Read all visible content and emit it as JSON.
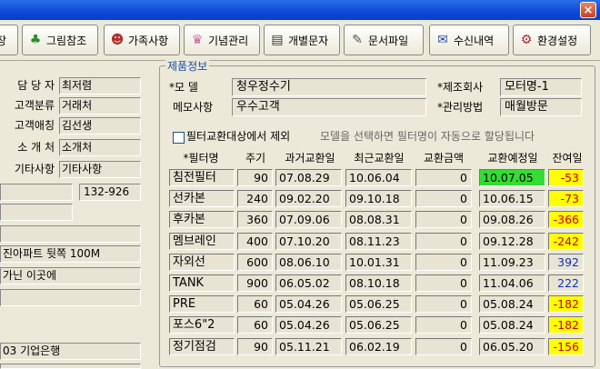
{
  "toolbar": {
    "buttons": [
      {
        "label": "장",
        "icon": "truncated-icon"
      },
      {
        "label": "그림참조",
        "icon": "tree-icon"
      },
      {
        "label": "가족사항",
        "icon": "family-icon"
      },
      {
        "label": "기념관리",
        "icon": "cake-icon"
      },
      {
        "label": "개별문자",
        "icon": "message-icon"
      },
      {
        "label": "문서파일",
        "icon": "document-icon"
      },
      {
        "label": "수신내역",
        "icon": "inbox-icon"
      },
      {
        "label": "환경설정",
        "icon": "settings-icon"
      }
    ]
  },
  "left": {
    "rows": [
      {
        "label": "담 당 자",
        "value": "최저렴"
      },
      {
        "label": "고객분류",
        "value": "거래처"
      },
      {
        "label": "고객애칭",
        "value": "김선생"
      },
      {
        "label": "소 개 처",
        "value": "소개처"
      },
      {
        "label": "기타사항",
        "value": "기타사항"
      }
    ],
    "postcode": "132-926",
    "address_line": "진아파트 뒷쪽 100M",
    "memo_line": "가닌 이곳에",
    "bank": "03 기업은행"
  },
  "product": {
    "section_title": "제품정보",
    "model_label": "*모    델",
    "model_value": "청우정수기",
    "manufacturer_label": "*제조회사",
    "manufacturer_value": "모터명-1",
    "memo_label": "메모사항",
    "memo_value": "우수고객",
    "manage_label": "*관리방법",
    "manage_value": "매월방문",
    "exclude_label": "필터교환대상에서 제외",
    "hint": "모델을 선택하면 필터명이 자동으로 할당됩니다",
    "columns": [
      "*필터명",
      "주기",
      "과거교환일",
      "최근교환일",
      "교환금액",
      "교환예정일",
      "잔여일"
    ],
    "rows": [
      {
        "name": "침전필터",
        "cycle": "90",
        "past": "07.08.29",
        "recent": "10.06.04",
        "amount": "0",
        "due": "10.07.05",
        "remain": "-53",
        "due_bg": "#33dd33",
        "remain_bg": "#ffff00",
        "remain_color": "#cc0000"
      },
      {
        "name": "선카본",
        "cycle": "240",
        "past": "09.02.20",
        "recent": "09.10.18",
        "amount": "0",
        "due": "10.06.15",
        "remain": "-73",
        "due_bg": "#e8e4d4",
        "remain_bg": "#ffff00",
        "remain_color": "#cc0000"
      },
      {
        "name": "후카본",
        "cycle": "360",
        "past": "07.09.06",
        "recent": "08.08.31",
        "amount": "0",
        "due": "09.08.26",
        "remain": "-366",
        "due_bg": "#e8e4d4",
        "remain_bg": "#ffff00",
        "remain_color": "#cc0000"
      },
      {
        "name": "멤브레인",
        "cycle": "400",
        "past": "07.10.20",
        "recent": "08.11.23",
        "amount": "0",
        "due": "09.12.28",
        "remain": "-242",
        "due_bg": "#e8e4d4",
        "remain_bg": "#ffff00",
        "remain_color": "#cc0000"
      },
      {
        "name": "자외선",
        "cycle": "600",
        "past": "08.06.10",
        "recent": "10.01.31",
        "amount": "0",
        "due": "11.09.23",
        "remain": "392",
        "due_bg": "#e8e4d4",
        "remain_bg": "#e8e4d4",
        "remain_color": "#1030c0"
      },
      {
        "name": "TANK",
        "cycle": "900",
        "past": "06.05.02",
        "recent": "08.10.18",
        "amount": "0",
        "due": "11.04.06",
        "remain": "222",
        "due_bg": "#e8e4d4",
        "remain_bg": "#e8e4d4",
        "remain_color": "#1030c0"
      },
      {
        "name": "PRE",
        "cycle": "60",
        "past": "05.04.26",
        "recent": "05.06.25",
        "amount": "0",
        "due": "05.08.24",
        "remain": "-182",
        "due_bg": "#e8e4d4",
        "remain_bg": "#ffff00",
        "remain_color": "#cc0000"
      },
      {
        "name": "포스6\"2",
        "cycle": "60",
        "past": "05.04.26",
        "recent": "05.06.25",
        "amount": "0",
        "due": "05.08.24",
        "remain": "-182",
        "due_bg": "#e8e4d4",
        "remain_bg": "#ffff00",
        "remain_color": "#cc0000"
      },
      {
        "name": "정기점검",
        "cycle": "90",
        "past": "05.11.21",
        "recent": "06.02.19",
        "amount": "0",
        "due": "06.05.20",
        "remain": "-156",
        "due_bg": "#e8e4d4",
        "remain_bg": "#ffff00",
        "remain_color": "#cc0000"
      }
    ]
  }
}
